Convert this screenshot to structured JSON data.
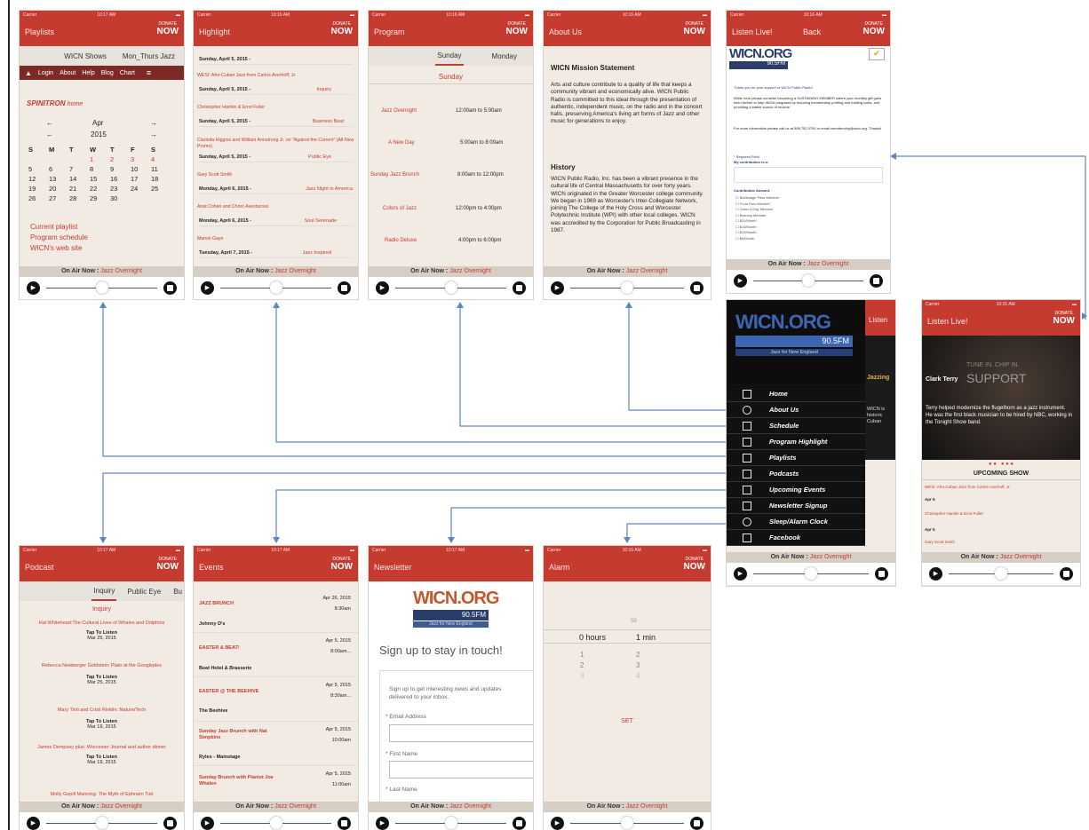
{
  "status": {
    "carrier": "Carrier",
    "battery": ""
  },
  "donate": {
    "top": "DONATE",
    "bottom": "NOW"
  },
  "player": {
    "on_air_label": "On Air Now :",
    "on_air_show": "Jazz Overnight"
  },
  "screens": {
    "playlists": {
      "title": "Playlists",
      "time": "10:17 AM",
      "tabs": [
        "WICN Shows",
        "Mon_Thurs Jazz"
      ],
      "nav": [
        "Login",
        "About",
        "Help",
        "Blog",
        "Chart"
      ],
      "spinitron": "SPINITRON",
      "home": "home",
      "month": "Apr",
      "year": "2015",
      "weekdays": [
        "S",
        "M",
        "T",
        "W",
        "T",
        "F",
        "S"
      ],
      "weeks": [
        [
          "",
          "",
          "",
          "1",
          "2",
          "3",
          "4"
        ],
        [
          "5",
          "6",
          "7",
          "8",
          "9",
          "10",
          "11"
        ],
        [
          "12",
          "13",
          "14",
          "15",
          "16",
          "17",
          "18"
        ],
        [
          "19",
          "20",
          "21",
          "22",
          "23",
          "24",
          "25"
        ],
        [
          "26",
          "27",
          "28",
          "29",
          "30",
          "",
          ""
        ]
      ],
      "links": [
        "Current playlist",
        "Program schedule",
        "WICN's web site"
      ]
    },
    "highlight": {
      "title": "Highlight",
      "time": "10:16 AM",
      "rows": [
        {
          "day": "Sunday, April 5, 2015 -"
        },
        {
          "item": "WESI: Afro-Cuban Jazz from Carlos Averhoff, Jr.",
          "show": ""
        },
        {
          "day": "Sunday, April 5, 2015 -",
          "show": "Inquiry"
        },
        {
          "item": "Christopher Hamlin & Errol Fuller",
          "show": ""
        },
        {
          "day": "Sunday, April 5, 2015 -",
          "show": "Business Beat"
        },
        {
          "item": "Clarinda Higgins and William Armstrong Jr. on \"Against the Current\" (All-New Promo)",
          "show": ""
        },
        {
          "day": "Sunday, April 5, 2015 -",
          "show": "Public Eye"
        },
        {
          "item": "Gary Scott Smith",
          "show": ""
        },
        {
          "day": "Monday, April 6, 2015 -",
          "show": "Jazz Night in America"
        },
        {
          "item": "Anat Cohen and Choro Aventuroso",
          "show": ""
        },
        {
          "day": "Monday, April 6, 2015 -",
          "show": "Soul Serenade"
        },
        {
          "item": "Marvin Gaye",
          "show": ""
        },
        {
          "day": "Tuesday, April 7, 2015 -",
          "show": "Jazz Inspired"
        }
      ]
    },
    "program": {
      "title": "Program",
      "time": "10:16 AM",
      "tabs": [
        "Sunday",
        "Monday"
      ],
      "heading": "Sunday",
      "rows": [
        {
          "name": "Jazz Overnight",
          "time": "12:00am to 5:00am"
        },
        {
          "name": "A New Day",
          "time": "5:00am to 8:00am"
        },
        {
          "name": "Sunday Jazz Brunch",
          "time": "8:00am to 12:00pm"
        },
        {
          "name": "Colors of Jazz",
          "time": "12:00pm to 4:00pm"
        },
        {
          "name": "Radio Deluxe",
          "time": "4:00pm to 6:00pm"
        }
      ]
    },
    "about": {
      "title": "About Us",
      "time": "10:16 AM",
      "h1": "WICN Mission Statement",
      "p1": "Arts and culture contribute to a quality of life that keeps a community vibrant and economically alive. WICN Public Radio is committed to this ideal through the presentation of authentic, independent music, on the radio and in the concert halls, preserving America's living art forms of Jazz and other music for generations to enjoy.",
      "h2": "History",
      "p2": "WICN Public Radio, Inc. has been a vibrant presence in the cultural life of Central Massachusetts for over forty years. WICN originated in the Greater Worcester college community. We began in 1969 as Worcester's Inter-Collegiate Network, joining The College of the Holy Cross and Worcester Polytechnic Institute (WPI) with other local colleges. WICN was accredited by the Corporation for Public Broadcasting in 1987."
    },
    "listen_form": {
      "title": "Listen Live!",
      "back": "Back",
      "time": "10:16 AM",
      "logo": "WICN.ORG",
      "freq": "90.5FM",
      "thanks": "Thank you for your support of WICN Public Radio!",
      "body": "While here please consider becoming a SUSTAINING MEMBER where your monthly gift goes even further to help WICN programs by reducing membership printing and mailing costs, and providing a stable source of income.",
      "contact": "For more information please call us at 508.752.0700 or email membership@wicn.org. Thanks!",
      "required": "* Required Field",
      "contrib": "My contribution is a:",
      "amount": "Contribution Amount:",
      "levels": [
        "Backstage Pass Member",
        "Front Row Member",
        "Order A Day Member",
        "Balcony Member",
        "$20/Month",
        "$15/Month",
        "$10/Month",
        "$5/Month"
      ]
    },
    "menu": {
      "logo": "WICN.ORG",
      "freq": "90.5FM",
      "tagline": "Jazz for New England",
      "peek_title": "Listen",
      "peek_items": [
        "Jazzing",
        "WICN is historic Cuban"
      ],
      "items": [
        "Home",
        "About Us",
        "Schedule",
        "Program Highlight",
        "Playlists",
        "Podcasts",
        "Upcoming Events",
        "Newsletter Signup",
        "Sleep/Alarm Clock",
        "Facebook"
      ]
    },
    "listen_live": {
      "title": "Listen Live!",
      "time": "10:15 AM",
      "tune": "TUNE IN. CHIP IN.",
      "support": "SUPPORT",
      "artist": "Clark Terry",
      "caption": "Terry helped modernize the flugelhorn as a jazz instrument. He was the first black musician to be hired by NBC, working in the Tonight Show band.",
      "upcoming": "UPCOMING SHOW",
      "rows": [
        {
          "item": "WESI: Afro-Cuban Jazz from Carlos Averhoff, Jr.",
          "day": "Apr 5"
        },
        {
          "item": "Christopher Hamlin & Errol Fuller",
          "day": "Apr 5"
        },
        {
          "item": "Gary Scott Smith",
          "day": ""
        }
      ]
    },
    "podcast": {
      "title": "Podcast",
      "time": "10:17 AM",
      "tabs": [
        "Inquiry",
        "Public Eye",
        "Bu"
      ],
      "heading": "Inquiry",
      "tap": "Tap To Listen",
      "items": [
        {
          "title": "Hal Whitehead:The Cultural Lives of Whales and Dolphins",
          "date": "Mar 25, 2015"
        },
        {
          "title": "Rebecca Newberger Goldstein: Plato at the Googleplex",
          "date": "Mar 25, 2015"
        },
        {
          "title": "Mary Tinti and Cristi Rinklin: Nature/Tech",
          "date": "Mar 19, 2015"
        },
        {
          "title": "James Dempsey plus: Worcester Journal and author dinner",
          "date": "Mar 19, 2015"
        },
        {
          "title": "Molly Gupill Manning: The Myth of Ephraim Tutt",
          "date": ""
        }
      ]
    },
    "events": {
      "title": "Events",
      "time": "10:17 AM",
      "items": [
        {
          "name": "JAZZ BRUNCH",
          "date": "Apr 26, 2015",
          "time": "8:30am",
          "venue": "Johnny D's"
        },
        {
          "name": "EASTER & BEAT!",
          "date": "Apr 5, 2015",
          "time": "8:00am...",
          "venue": "Beat Hotel & Brasserie"
        },
        {
          "name": "EASTER @ THE BEEHIVE",
          "date": "Apr 5, 2015",
          "time": "8:30am...",
          "venue": "The Beehive"
        },
        {
          "name": "Sunday Jazz Brunch with Nat Simpkins",
          "date": "Apr 5, 2015",
          "time": "10:00am",
          "venue": "Ryles - Mainstage"
        },
        {
          "name": "Sunday Brunch with Pianist Joe Whalen",
          "date": "Apr 5, 2015",
          "time": "11:00am",
          "venue": ""
        }
      ]
    },
    "newsletter": {
      "title": "Newsletter",
      "time": "10:17 AM",
      "logo": "WICN.ORG",
      "freq": "90.5FM",
      "tagline": "Jazz for New England",
      "heading": "Sign up to stay in touch!",
      "intro": "Sign up to get interesting news and updates delivered to your inbox.",
      "f1": "* Email Address",
      "f2": "* First Name",
      "f3": "* Last Name"
    },
    "alarm": {
      "title": "Alarm",
      "time": "10:16 AM",
      "above": [
        "",
        "59"
      ],
      "hours": "0 hours",
      "mins": "1 min",
      "below_h": [
        "1",
        "2",
        "3"
      ],
      "below_m": [
        "2",
        "3",
        "4"
      ],
      "set": "SET"
    }
  }
}
